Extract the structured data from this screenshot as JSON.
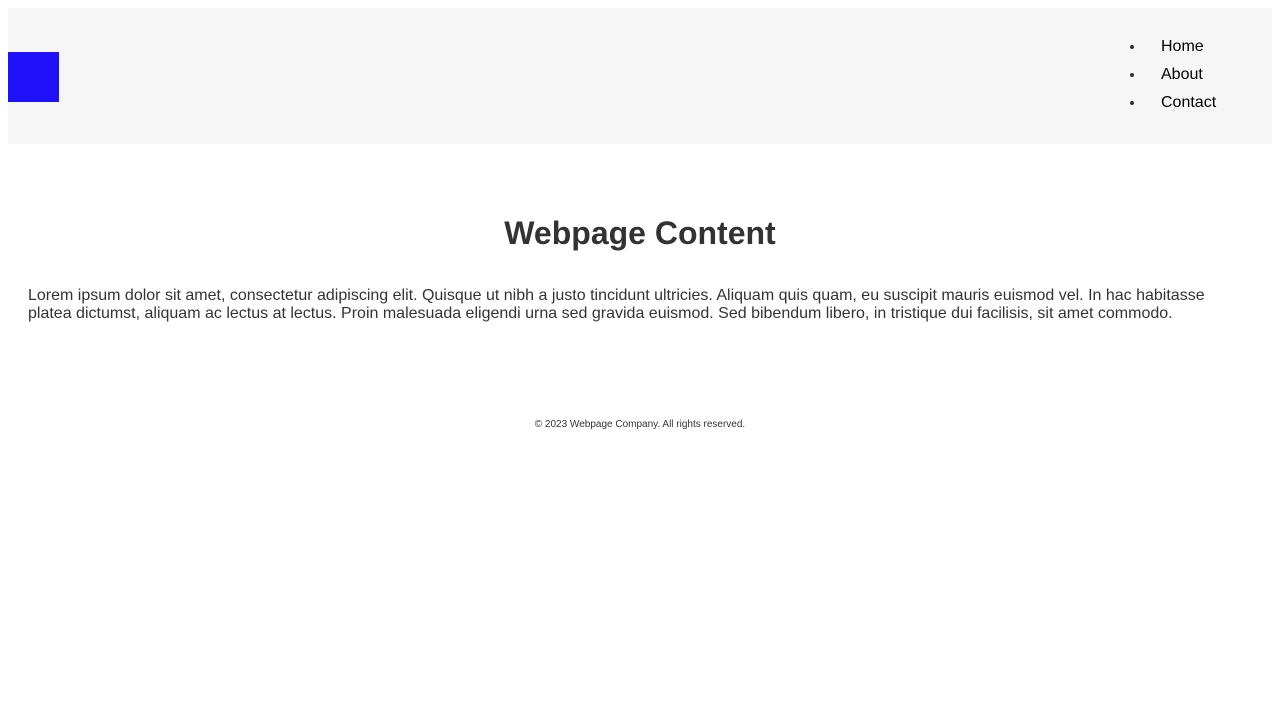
{
  "header": {
    "logo_color": "#1f12fa",
    "nav": [
      {
        "label": "Home"
      },
      {
        "label": "About"
      },
      {
        "label": "Contact"
      }
    ]
  },
  "main": {
    "title": "Webpage Content",
    "paragraph": "Lorem ipsum dolor sit amet, consectetur adipiscing elit. Quisque ut nibh a justo tincidunt ultricies. Aliquam quis quam, eu suscipit mauris euismod vel. In hac habitasse platea dictumst, aliquam ac lectus at lectus. Proin malesuada eligendi urna sed gravida euismod. Sed bibendum libero, in tristique dui facilisis, sit amet commodo."
  },
  "footer": {
    "text": "© 2023 Webpage Company. All rights reserved."
  },
  "colors": {
    "header_bg": "#f6f6f6",
    "text": "#333333",
    "link": "#000000"
  }
}
